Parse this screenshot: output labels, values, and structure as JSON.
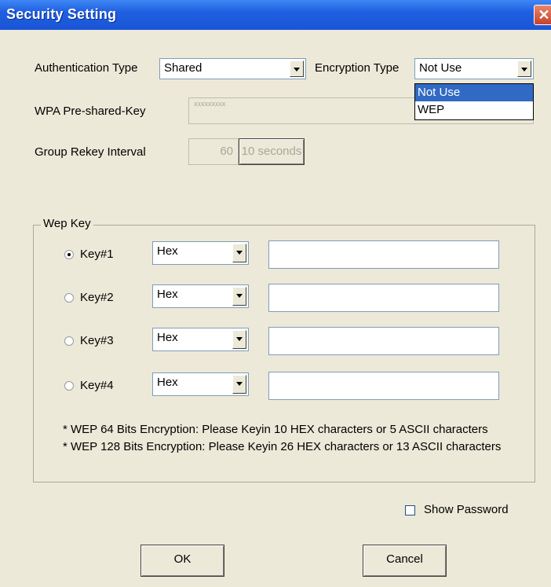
{
  "window": {
    "title": "Security Setting",
    "close_glyph": "✕"
  },
  "auth": {
    "label": "Authentication Type",
    "value": "Shared"
  },
  "encryption": {
    "label": "Encryption Type",
    "value": "Not Use",
    "options": [
      "Not Use",
      "WEP"
    ],
    "highlighted": "Not Use"
  },
  "wpa": {
    "label": "WPA Pre-shared-Key",
    "value": "xxxxxxxxx"
  },
  "rekey": {
    "label": "Group Rekey Interval",
    "value": "60",
    "unit": "10 seconds"
  },
  "wep": {
    "legend": "Wep Key",
    "keys": [
      {
        "label": "Key#1",
        "format": "Hex",
        "value": "",
        "selected": true
      },
      {
        "label": "Key#2",
        "format": "Hex",
        "value": "",
        "selected": false
      },
      {
        "label": "Key#3",
        "format": "Hex",
        "value": "",
        "selected": false
      },
      {
        "label": "Key#4",
        "format": "Hex",
        "value": "",
        "selected": false
      }
    ],
    "note1": "* WEP 64 Bits Encryption:  Please Keyin 10 HEX characters or 5 ASCII characters",
    "note2": "* WEP 128 Bits Encryption:  Please Keyin 26 HEX characters or 13 ASCII characters"
  },
  "show_password": {
    "label": "Show Password",
    "checked": false
  },
  "buttons": {
    "ok": "OK",
    "cancel": "Cancel"
  }
}
